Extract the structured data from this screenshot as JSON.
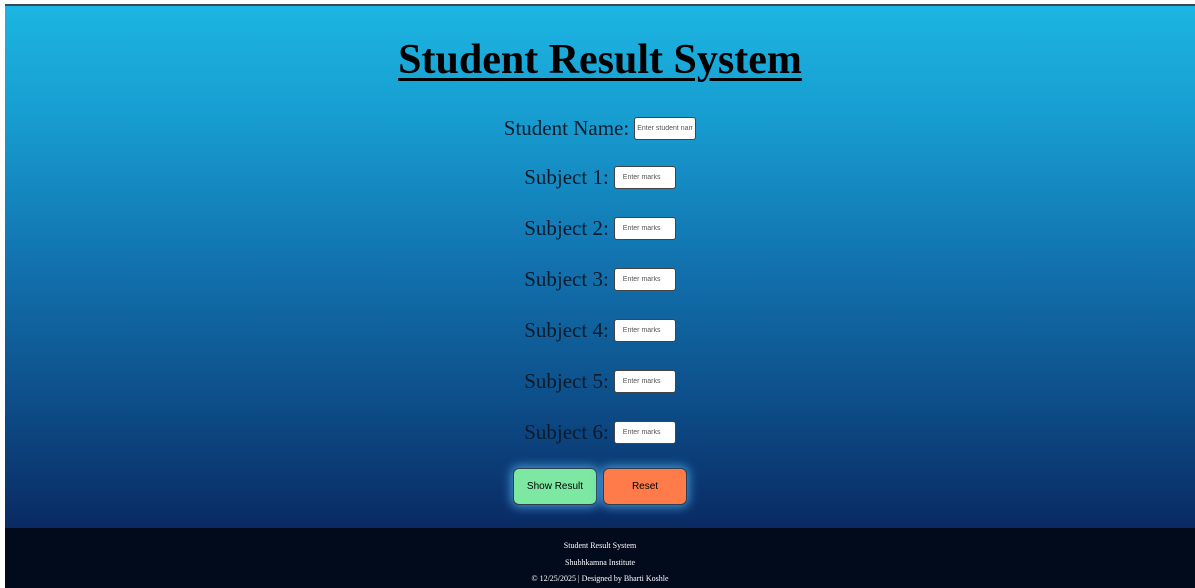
{
  "header": {
    "title": "Student Result System"
  },
  "form": {
    "student_name": {
      "label": "Student Name:",
      "placeholder": "Enter student name"
    },
    "subjects": [
      {
        "label": "Subject 1:",
        "placeholder": "Enter marks"
      },
      {
        "label": "Subject 2:",
        "placeholder": "Enter marks"
      },
      {
        "label": "Subject 3:",
        "placeholder": "Enter marks"
      },
      {
        "label": "Subject 4:",
        "placeholder": "Enter marks"
      },
      {
        "label": "Subject 5:",
        "placeholder": "Enter marks"
      },
      {
        "label": "Subject 6:",
        "placeholder": "Enter marks"
      }
    ]
  },
  "buttons": {
    "show_result": "Show Result",
    "reset": "Reset"
  },
  "footer": {
    "line1": "Student Result System",
    "line2": "Shubhkamna Institute",
    "line3": "© 12/25/2025 | Designed by Bharti Koshle"
  },
  "colors": {
    "gradient_top": "#1cb5e2",
    "gradient_bottom": "#0a2a63",
    "show_button": "#7ce8a2",
    "reset_button": "#ff7b4a",
    "footer_bg": "#020b1c"
  }
}
